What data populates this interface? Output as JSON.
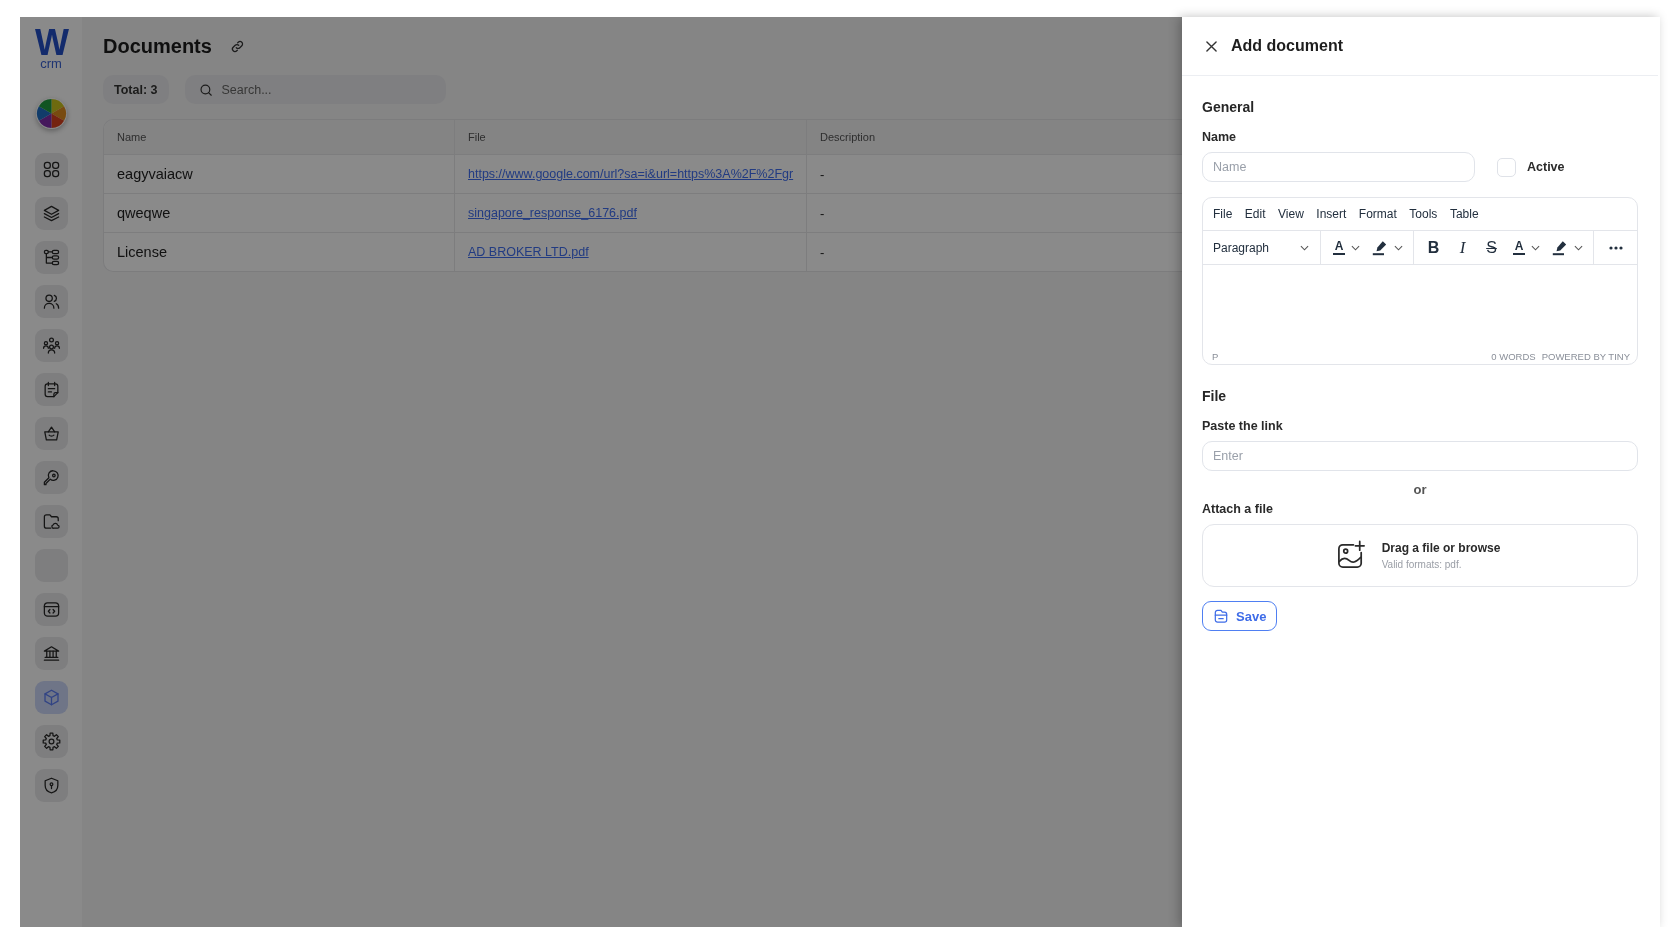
{
  "sidebar": {
    "logo": {
      "mark": "W",
      "text": "crm"
    },
    "items": [
      {
        "selected": false
      },
      {
        "selected": false
      },
      {
        "selected": false
      },
      {
        "selected": false
      },
      {
        "selected": false
      },
      {
        "selected": false
      },
      {
        "selected": false
      },
      {
        "selected": false
      },
      {
        "selected": false
      },
      {
        "selected": false
      },
      {
        "selected": false
      },
      {
        "selected": false
      },
      {
        "selected": true
      },
      {
        "selected": false
      },
      {
        "selected": false
      }
    ]
  },
  "header": {
    "title": "Documents",
    "total": "Total: 3",
    "search": {
      "placeholder": "Search..."
    }
  },
  "table": {
    "columns": [
      "Name",
      "File",
      "Description"
    ],
    "rows": [
      {
        "name": "eagyvaiacw",
        "file": "https://www.google.com/url?sa=i&url=https%3A%2F%2Fgr",
        "description": "-"
      },
      {
        "name": "qweqwe",
        "file": "singapore_response_6176.pdf",
        "description": "-"
      },
      {
        "name": "License",
        "file": "AD BROKER LTD.pdf",
        "description": "-"
      }
    ]
  },
  "panel": {
    "title": "Add document",
    "general": {
      "heading": "General",
      "name_label": "Name",
      "name_field": {
        "placeholder": "Name"
      },
      "active": {
        "label": "Active",
        "checked": false
      }
    },
    "editor": {
      "menu": [
        "File",
        "Edit",
        "View",
        "Insert",
        "Format",
        "Tools",
        "Table"
      ],
      "toolbar": [
        {
          "items": [
            {
              "kind": "select",
              "label": "Paragraph"
            }
          ]
        },
        {
          "items": [
            {
              "kind": "text-color",
              "label": "A"
            },
            {
              "kind": "highlight"
            }
          ]
        },
        {
          "items": [
            {
              "kind": "bold",
              "label": "B"
            },
            {
              "kind": "italic",
              "label": "I"
            },
            {
              "kind": "strike",
              "label": "S"
            },
            {
              "kind": "text-color",
              "label": "A"
            },
            {
              "kind": "highlight"
            }
          ]
        },
        {
          "items": [
            {
              "kind": "more"
            }
          ]
        }
      ],
      "status_path": "P",
      "word_count": "0 WORDS",
      "branding": "POWERED BY TINY"
    },
    "file": {
      "heading": "File",
      "link_label": "Paste the link",
      "link_field": {
        "placeholder": "Enter"
      },
      "separator": "or",
      "attach_label": "Attach a file",
      "dropzone": {
        "title": "Drag a file or browse",
        "hint": "Valid formats: pdf."
      }
    },
    "save_button": "Save"
  }
}
